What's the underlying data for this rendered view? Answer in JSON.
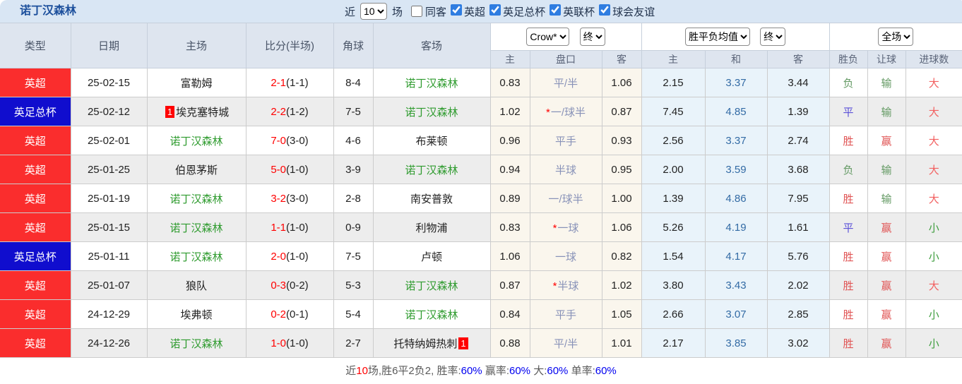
{
  "topbar": {
    "title": "诺丁汉森林",
    "near_label": "近",
    "near_value": "10",
    "games_label": "场",
    "same_away": {
      "label": "同客",
      "checked": false
    },
    "filters": [
      {
        "label": "英超",
        "checked": true
      },
      {
        "label": "英足总杯",
        "checked": true
      },
      {
        "label": "英联杯",
        "checked": true
      },
      {
        "label": "球会友谊",
        "checked": true
      }
    ]
  },
  "header": {
    "cols": [
      "类型",
      "日期",
      "主场",
      "比分(半场)",
      "角球",
      "客场"
    ],
    "bookmaker_select": "Crow*",
    "odds_time_select": "终",
    "avg_select": "胜平负均值",
    "avg_time_select": "终",
    "scope_select": "全场",
    "sub": [
      "主",
      "盘口",
      "客",
      "主",
      "和",
      "客",
      "胜负",
      "让球",
      "进球数"
    ]
  },
  "rows": [
    {
      "league": "英超",
      "league_type": "epl",
      "date": "25-02-15",
      "home": {
        "name": "富勒姆",
        "forest": false
      },
      "score": "2-1",
      "half": "(1-1)",
      "corner": "8-4",
      "away": {
        "name": "诺丁汉森林",
        "forest": true
      },
      "odds_home": "0.83",
      "handicap": "平/半",
      "star": false,
      "odds_away": "1.06",
      "avg_win": "2.15",
      "avg_draw": "3.37",
      "avg_lose": "3.44",
      "result": {
        "text": "负",
        "type": "lose"
      },
      "handicap_result": {
        "text": "输",
        "type": "lose"
      },
      "goals": {
        "text": "大",
        "type": "big"
      }
    },
    {
      "league": "英足总杯",
      "league_type": "facup",
      "date": "25-02-12",
      "home": {
        "name": "埃克塞特城",
        "forest": false,
        "badge_before": "1"
      },
      "score": "2-2",
      "half": "(1-2)",
      "corner": "7-5",
      "away": {
        "name": "诺丁汉森林",
        "forest": true
      },
      "odds_home": "1.02",
      "handicap": "一/球半",
      "star": true,
      "odds_away": "0.87",
      "avg_win": "7.45",
      "avg_draw": "4.85",
      "avg_lose": "1.39",
      "result": {
        "text": "平",
        "type": "draw"
      },
      "handicap_result": {
        "text": "输",
        "type": "lose"
      },
      "goals": {
        "text": "大",
        "type": "big"
      }
    },
    {
      "league": "英超",
      "league_type": "epl",
      "date": "25-02-01",
      "home": {
        "name": "诺丁汉森林",
        "forest": true
      },
      "score": "7-0",
      "half": "(3-0)",
      "corner": "4-6",
      "away": {
        "name": "布莱顿",
        "forest": false
      },
      "odds_home": "0.96",
      "handicap": "平手",
      "star": false,
      "odds_away": "0.93",
      "avg_win": "2.56",
      "avg_draw": "3.37",
      "avg_lose": "2.74",
      "result": {
        "text": "胜",
        "type": "win"
      },
      "handicap_result": {
        "text": "赢",
        "type": "win"
      },
      "goals": {
        "text": "大",
        "type": "big"
      }
    },
    {
      "league": "英超",
      "league_type": "epl",
      "date": "25-01-25",
      "home": {
        "name": "伯恩茅斯",
        "forest": false
      },
      "score": "5-0",
      "half": "(1-0)",
      "corner": "3-9",
      "away": {
        "name": "诺丁汉森林",
        "forest": true
      },
      "odds_home": "0.94",
      "handicap": "半球",
      "star": false,
      "odds_away": "0.95",
      "avg_win": "2.00",
      "avg_draw": "3.59",
      "avg_lose": "3.68",
      "result": {
        "text": "负",
        "type": "lose"
      },
      "handicap_result": {
        "text": "输",
        "type": "lose"
      },
      "goals": {
        "text": "大",
        "type": "big"
      }
    },
    {
      "league": "英超",
      "league_type": "epl",
      "date": "25-01-19",
      "home": {
        "name": "诺丁汉森林",
        "forest": true
      },
      "score": "3-2",
      "half": "(3-0)",
      "corner": "2-8",
      "away": {
        "name": "南安普敦",
        "forest": false
      },
      "odds_home": "0.89",
      "handicap": "一/球半",
      "star": false,
      "odds_away": "1.00",
      "avg_win": "1.39",
      "avg_draw": "4.86",
      "avg_lose": "7.95",
      "result": {
        "text": "胜",
        "type": "win"
      },
      "handicap_result": {
        "text": "输",
        "type": "lose"
      },
      "goals": {
        "text": "大",
        "type": "big"
      }
    },
    {
      "league": "英超",
      "league_type": "epl",
      "date": "25-01-15",
      "home": {
        "name": "诺丁汉森林",
        "forest": true
      },
      "score": "1-1",
      "half": "(1-0)",
      "corner": "0-9",
      "away": {
        "name": "利物浦",
        "forest": false
      },
      "odds_home": "0.83",
      "handicap": "一球",
      "star": true,
      "odds_away": "1.06",
      "avg_win": "5.26",
      "avg_draw": "4.19",
      "avg_lose": "1.61",
      "result": {
        "text": "平",
        "type": "draw"
      },
      "handicap_result": {
        "text": "赢",
        "type": "win"
      },
      "goals": {
        "text": "小",
        "type": "small"
      }
    },
    {
      "league": "英足总杯",
      "league_type": "facup",
      "date": "25-01-11",
      "home": {
        "name": "诺丁汉森林",
        "forest": true
      },
      "score": "2-0",
      "half": "(1-0)",
      "corner": "7-5",
      "away": {
        "name": "卢顿",
        "forest": false
      },
      "odds_home": "1.06",
      "handicap": "一球",
      "star": false,
      "odds_away": "0.82",
      "avg_win": "1.54",
      "avg_draw": "4.17",
      "avg_lose": "5.76",
      "result": {
        "text": "胜",
        "type": "win"
      },
      "handicap_result": {
        "text": "赢",
        "type": "win"
      },
      "goals": {
        "text": "小",
        "type": "small"
      }
    },
    {
      "league": "英超",
      "league_type": "epl",
      "date": "25-01-07",
      "home": {
        "name": "狼队",
        "forest": false
      },
      "score": "0-3",
      "half": "(0-2)",
      "corner": "5-3",
      "away": {
        "name": "诺丁汉森林",
        "forest": true
      },
      "odds_home": "0.87",
      "handicap": "半球",
      "star": true,
      "odds_away": "1.02",
      "avg_win": "3.80",
      "avg_draw": "3.43",
      "avg_lose": "2.02",
      "result": {
        "text": "胜",
        "type": "win"
      },
      "handicap_result": {
        "text": "赢",
        "type": "win"
      },
      "goals": {
        "text": "大",
        "type": "big"
      }
    },
    {
      "league": "英超",
      "league_type": "epl",
      "date": "24-12-29",
      "home": {
        "name": "埃弗顿",
        "forest": false
      },
      "score": "0-2",
      "half": "(0-1)",
      "corner": "5-4",
      "away": {
        "name": "诺丁汉森林",
        "forest": true
      },
      "odds_home": "0.84",
      "handicap": "平手",
      "star": false,
      "odds_away": "1.05",
      "avg_win": "2.66",
      "avg_draw": "3.07",
      "avg_lose": "2.85",
      "result": {
        "text": "胜",
        "type": "win"
      },
      "handicap_result": {
        "text": "赢",
        "type": "win"
      },
      "goals": {
        "text": "小",
        "type": "small"
      }
    },
    {
      "league": "英超",
      "league_type": "epl",
      "date": "24-12-26",
      "home": {
        "name": "诺丁汉森林",
        "forest": true
      },
      "score": "1-0",
      "half": "(1-0)",
      "corner": "2-7",
      "away": {
        "name": "托特纳姆热刺",
        "forest": false,
        "badge_after": "1"
      },
      "odds_home": "0.88",
      "handicap": "平/半",
      "star": false,
      "odds_away": "1.01",
      "avg_win": "2.17",
      "avg_draw": "3.85",
      "avg_lose": "3.02",
      "result": {
        "text": "胜",
        "type": "win"
      },
      "handicap_result": {
        "text": "赢",
        "type": "win"
      },
      "goals": {
        "text": "小",
        "type": "small"
      }
    }
  ],
  "summary": {
    "parts": [
      {
        "text": "近",
        "color": "gray"
      },
      {
        "text": "10",
        "color": "red"
      },
      {
        "text": "场,胜6平2负2, 胜率:",
        "color": "gray"
      },
      {
        "text": "60%",
        "color": "blue"
      },
      {
        "text": " 赢率:",
        "color": "gray"
      },
      {
        "text": "60%",
        "color": "blue"
      },
      {
        "text": " 大:",
        "color": "gray"
      },
      {
        "text": "60%",
        "color": "blue"
      },
      {
        "text": " 单率:",
        "color": "gray"
      },
      {
        "text": "60%",
        "color": "blue"
      }
    ]
  },
  "colors": {
    "epl_red": "#fa2d2d",
    "facup_blue": "#100dce",
    "forest_green": "#2e9b2e",
    "score_red": "#ff0000",
    "avg_draw_blue": "#336ba5",
    "crow_bg": "#faf6ed",
    "avg_bg": "#e9f3fa",
    "topbar_bg": "#d9e6f4",
    "header_bg": "#dee5ef"
  }
}
